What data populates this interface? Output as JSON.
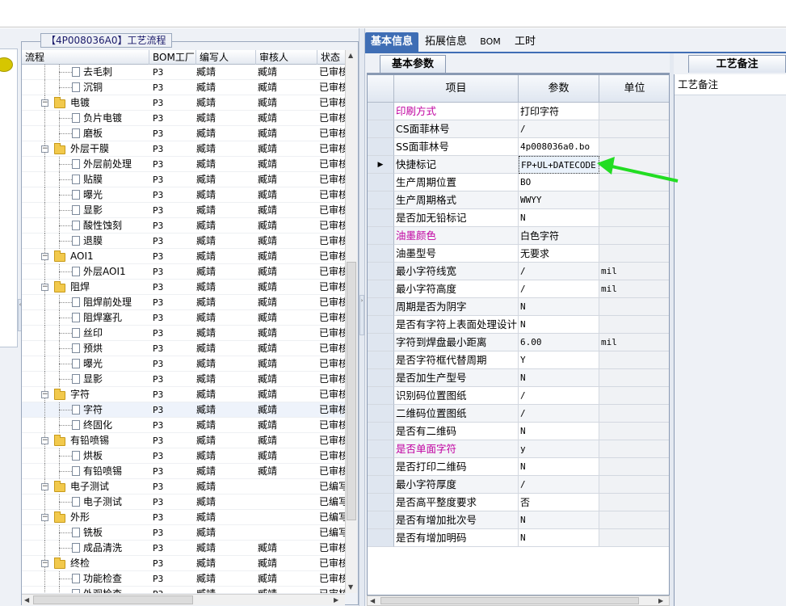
{
  "left_panel": {
    "group_title": "【4P008036A0】工艺流程",
    "columns": [
      "流程",
      "BOM工厂",
      "编写人",
      "审核人",
      "状态"
    ],
    "rows": [
      {
        "label": "去毛刺",
        "level": 1,
        "folder": false,
        "bom": "P3",
        "writer": "臧靖",
        "reviewer": "臧靖",
        "status": "已审核"
      },
      {
        "label": "沉铜",
        "level": 1,
        "folder": false,
        "bom": "P3",
        "writer": "臧靖",
        "reviewer": "臧靖",
        "status": "已审核"
      },
      {
        "label": "电镀",
        "level": 0,
        "folder": true,
        "bom": "P3",
        "writer": "臧靖",
        "reviewer": "臧靖",
        "status": "已审核"
      },
      {
        "label": "负片电镀",
        "level": 1,
        "folder": false,
        "bom": "P3",
        "writer": "臧靖",
        "reviewer": "臧靖",
        "status": "已审核"
      },
      {
        "label": "磨板",
        "level": 1,
        "folder": false,
        "bom": "P3",
        "writer": "臧靖",
        "reviewer": "臧靖",
        "status": "已审核"
      },
      {
        "label": "外层干膜",
        "level": 0,
        "folder": true,
        "bom": "P3",
        "writer": "臧靖",
        "reviewer": "臧靖",
        "status": "已审核"
      },
      {
        "label": "外层前处理",
        "level": 1,
        "folder": false,
        "bom": "P3",
        "writer": "臧靖",
        "reviewer": "臧靖",
        "status": "已审核"
      },
      {
        "label": "贴膜",
        "level": 1,
        "folder": false,
        "bom": "P3",
        "writer": "臧靖",
        "reviewer": "臧靖",
        "status": "已审核"
      },
      {
        "label": "曝光",
        "level": 1,
        "folder": false,
        "bom": "P3",
        "writer": "臧靖",
        "reviewer": "臧靖",
        "status": "已审核"
      },
      {
        "label": "显影",
        "level": 1,
        "folder": false,
        "bom": "P3",
        "writer": "臧靖",
        "reviewer": "臧靖",
        "status": "已审核"
      },
      {
        "label": "酸性蚀刻",
        "level": 1,
        "folder": false,
        "bom": "P3",
        "writer": "臧靖",
        "reviewer": "臧靖",
        "status": "已审核"
      },
      {
        "label": "退膜",
        "level": 1,
        "folder": false,
        "bom": "P3",
        "writer": "臧靖",
        "reviewer": "臧靖",
        "status": "已审核"
      },
      {
        "label": "AOI1",
        "level": 0,
        "folder": true,
        "bom": "P3",
        "writer": "臧靖",
        "reviewer": "臧靖",
        "status": "已审核"
      },
      {
        "label": "外层AOI1",
        "level": 1,
        "folder": false,
        "bom": "P3",
        "writer": "臧靖",
        "reviewer": "臧靖",
        "status": "已审核"
      },
      {
        "label": "阻焊",
        "level": 0,
        "folder": true,
        "bom": "P3",
        "writer": "臧靖",
        "reviewer": "臧靖",
        "status": "已审核"
      },
      {
        "label": "阻焊前处理",
        "level": 1,
        "folder": false,
        "bom": "P3",
        "writer": "臧靖",
        "reviewer": "臧靖",
        "status": "已审核"
      },
      {
        "label": "阻焊塞孔",
        "level": 1,
        "folder": false,
        "bom": "P3",
        "writer": "臧靖",
        "reviewer": "臧靖",
        "status": "已审核"
      },
      {
        "label": "丝印",
        "level": 1,
        "folder": false,
        "bom": "P3",
        "writer": "臧靖",
        "reviewer": "臧靖",
        "status": "已审核"
      },
      {
        "label": "预烘",
        "level": 1,
        "folder": false,
        "bom": "P3",
        "writer": "臧靖",
        "reviewer": "臧靖",
        "status": "已审核"
      },
      {
        "label": "曝光",
        "level": 1,
        "folder": false,
        "bom": "P3",
        "writer": "臧靖",
        "reviewer": "臧靖",
        "status": "已审核"
      },
      {
        "label": "显影",
        "level": 1,
        "folder": false,
        "bom": "P3",
        "writer": "臧靖",
        "reviewer": "臧靖",
        "status": "已审核"
      },
      {
        "label": "字符",
        "level": 0,
        "folder": true,
        "bom": "P3",
        "writer": "臧靖",
        "reviewer": "臧靖",
        "status": "已审核"
      },
      {
        "label": "字符",
        "level": 1,
        "folder": false,
        "bom": "P3",
        "writer": "臧靖",
        "reviewer": "臧靖",
        "status": "已审核",
        "selected": true
      },
      {
        "label": "终固化",
        "level": 1,
        "folder": false,
        "bom": "P3",
        "writer": "臧靖",
        "reviewer": "臧靖",
        "status": "已审核"
      },
      {
        "label": "有铅喷锡",
        "level": 0,
        "folder": true,
        "bom": "P3",
        "writer": "臧靖",
        "reviewer": "臧靖",
        "status": "已审核"
      },
      {
        "label": "烘板",
        "level": 1,
        "folder": false,
        "bom": "P3",
        "writer": "臧靖",
        "reviewer": "臧靖",
        "status": "已审核"
      },
      {
        "label": "有铅喷锡",
        "level": 1,
        "folder": false,
        "bom": "P3",
        "writer": "臧靖",
        "reviewer": "臧靖",
        "status": "已审核"
      },
      {
        "label": "电子测试",
        "level": 0,
        "folder": true,
        "bom": "P3",
        "writer": "臧靖",
        "reviewer": "",
        "status": "已编写"
      },
      {
        "label": "电子测试",
        "level": 1,
        "folder": false,
        "bom": "P3",
        "writer": "臧靖",
        "reviewer": "",
        "status": "已编写"
      },
      {
        "label": "外形",
        "level": 0,
        "folder": true,
        "bom": "P3",
        "writer": "臧靖",
        "reviewer": "",
        "status": "已编写"
      },
      {
        "label": "铣板",
        "level": 1,
        "folder": false,
        "bom": "P3",
        "writer": "臧靖",
        "reviewer": "",
        "status": "已编写"
      },
      {
        "label": "成品清洗",
        "level": 1,
        "folder": false,
        "bom": "P3",
        "writer": "臧靖",
        "reviewer": "臧靖",
        "status": "已审核"
      },
      {
        "label": "终检",
        "level": 0,
        "folder": true,
        "bom": "P3",
        "writer": "臧靖",
        "reviewer": "臧靖",
        "status": "已审核"
      },
      {
        "label": "功能检查",
        "level": 1,
        "folder": false,
        "bom": "P3",
        "writer": "臧靖",
        "reviewer": "臧靖",
        "status": "已审核"
      },
      {
        "label": "外观检查",
        "level": 1,
        "folder": false,
        "bom": "P3",
        "writer": "臧靖",
        "reviewer": "臧靖",
        "status": "已审核"
      }
    ]
  },
  "top_tabs": [
    {
      "label": "基本信息",
      "active": true
    },
    {
      "label": "拓展信息",
      "active": false
    },
    {
      "label": "BOM",
      "active": false
    },
    {
      "label": "工时",
      "active": false
    }
  ],
  "sub_tab": "基本参数",
  "param_grid": {
    "headers": {
      "item": "项目",
      "param": "参数",
      "unit": "单位"
    },
    "rows": [
      {
        "item": "印刷方式",
        "param": "打印字符",
        "unit": "",
        "highlight": true
      },
      {
        "item": "CS面菲林号",
        "param": "/",
        "unit": ""
      },
      {
        "item": "SS面菲林号",
        "param": "4p008036a0.bo",
        "unit": ""
      },
      {
        "item": "快捷标记",
        "param": "FP+UL+DATECODE",
        "unit": "",
        "current": true
      },
      {
        "item": "生产周期位置",
        "param": "BO",
        "unit": ""
      },
      {
        "item": "生产周期格式",
        "param": "WWYY",
        "unit": ""
      },
      {
        "item": "是否加无铅标记",
        "param": "N",
        "unit": ""
      },
      {
        "item": "油墨颜色",
        "param": "白色字符",
        "unit": "",
        "highlight": true
      },
      {
        "item": "油墨型号",
        "param": "无要求",
        "unit": ""
      },
      {
        "item": "最小字符线宽",
        "param": "/",
        "unit": "mil"
      },
      {
        "item": "最小字符高度",
        "param": "/",
        "unit": "mil"
      },
      {
        "item": "周期是否为阴字",
        "param": "N",
        "unit": ""
      },
      {
        "item": "是否有字符上表面处理设计",
        "param": "N",
        "unit": ""
      },
      {
        "item": "字符到焊盘最小距离",
        "param": "6.00",
        "unit": "mil"
      },
      {
        "item": "是否字符框代替周期",
        "param": "Y",
        "unit": ""
      },
      {
        "item": "是否加生产型号",
        "param": "N",
        "unit": ""
      },
      {
        "item": "识别码位置图纸",
        "param": "/",
        "unit": ""
      },
      {
        "item": "二维码位置图纸",
        "param": "/",
        "unit": ""
      },
      {
        "item": "是否有二维码",
        "param": "N",
        "unit": ""
      },
      {
        "item": "是否单面字符",
        "param": "y",
        "unit": "",
        "highlight": true
      },
      {
        "item": "是否打印二维码",
        "param": "N",
        "unit": ""
      },
      {
        "item": "最小字符厚度",
        "param": "/",
        "unit": ""
      },
      {
        "item": "是否高平整度要求",
        "param": "否",
        "unit": ""
      },
      {
        "item": "是否有增加批次号",
        "param": "N",
        "unit": ""
      },
      {
        "item": "是否有增加明码",
        "param": "N",
        "unit": ""
      }
    ]
  },
  "right_panel": {
    "tab": "工艺备注",
    "header": "工艺备注"
  },
  "colors": {
    "accent": "#3f6eb5",
    "highlight_text": "#c000a0",
    "arrow": "#22dd22"
  }
}
